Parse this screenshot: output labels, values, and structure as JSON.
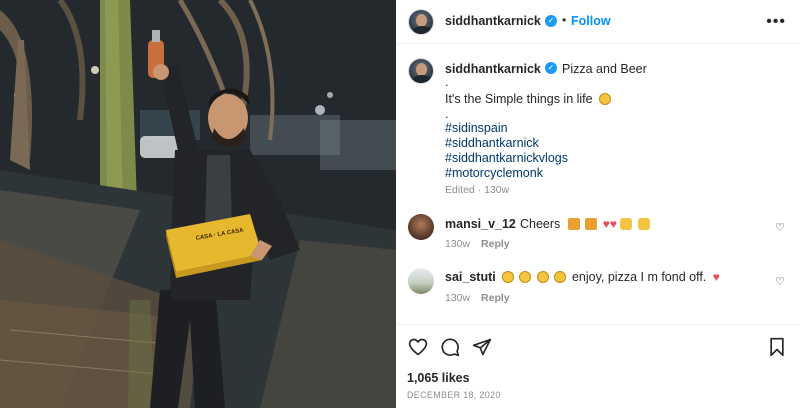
{
  "header": {
    "username": "siddhantkarnick",
    "separator": "•",
    "follow_label": "Follow",
    "more_label": "•••"
  },
  "caption": {
    "username": "siddhantkarnick",
    "text": "Pizza and Beer",
    "dot1": ".",
    "line2": "It's the Simple things in life",
    "dot2": ".",
    "hashtags": [
      "#sidinspain",
      "#siddhantkarnick",
      "#siddhantkarnickvlogs",
      "#motorcyclemonk"
    ],
    "edited_time": "Edited · 130w"
  },
  "comments": [
    {
      "username": "mansi_v_12",
      "text": "Cheers",
      "time": "130w",
      "reply_label": "Reply"
    },
    {
      "username": "sai_stuti",
      "text": "enjoy, pizza I m fond off.",
      "time": "130w",
      "reply_label": "Reply"
    }
  ],
  "footer": {
    "likes": "1,065 likes",
    "date": "DECEMBER 18, 2020"
  },
  "colors": {
    "accent": "#0095f6",
    "hashtag": "#00376b",
    "verified": "#1d9bf0",
    "heart": "#ed4956"
  },
  "icons": [
    "verified-badge-icon",
    "more-options-icon",
    "like-heart-icon",
    "comment-icon",
    "share-icon",
    "save-bookmark-icon",
    "emoji-smile-icon"
  ]
}
